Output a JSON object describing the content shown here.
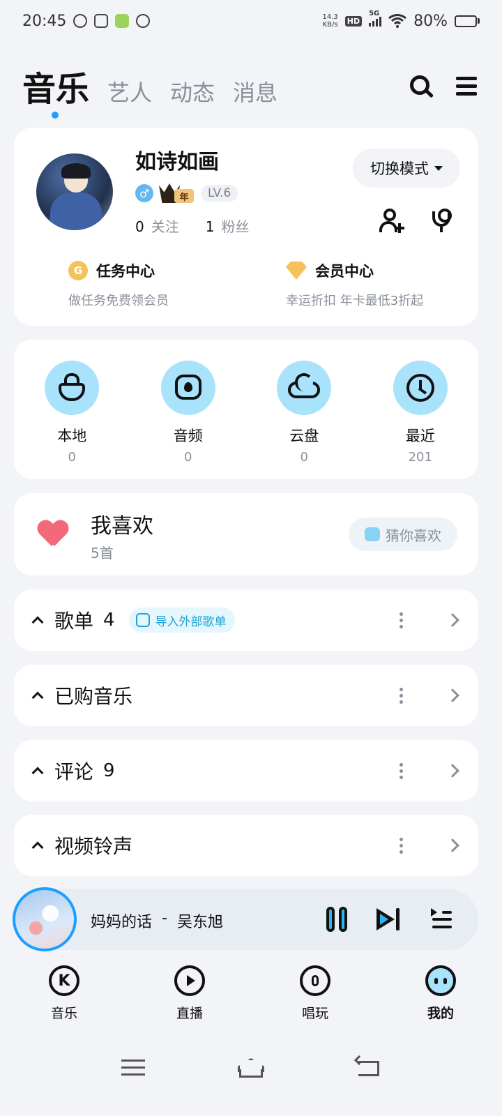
{
  "status_bar": {
    "time": "20:45",
    "net_speed_value": "14.3",
    "net_speed_unit": "KB/s",
    "hd": "HD",
    "network": "5G",
    "battery_text": "80%",
    "battery_level": 0.8
  },
  "top_nav": {
    "tabs": [
      {
        "label": "音乐",
        "active": true
      },
      {
        "label": "艺人"
      },
      {
        "label": "动态"
      },
      {
        "label": "消息"
      }
    ],
    "search_icon": "search-icon",
    "menu_icon": "menu-icon"
  },
  "profile": {
    "username": "如诗如画",
    "gender_symbol": "♂",
    "vip_badge_text": "年",
    "level": "LV.6",
    "following_count": "0",
    "following_label": "关注",
    "followers_count": "1",
    "followers_label": "粉丝",
    "mode_button": "切换模式",
    "tasks": {
      "icon_letter": "G",
      "title": "任务中心",
      "subtitle": "做任务免费领会员"
    },
    "vip": {
      "title": "会员中心",
      "subtitle": "幸运折扣 年卡最低3折起"
    }
  },
  "library": {
    "items": [
      {
        "label": "本地",
        "count": "0",
        "icon": "local-bag-icon"
      },
      {
        "label": "音频",
        "count": "0",
        "icon": "audio-icon"
      },
      {
        "label": "云盘",
        "count": "0",
        "icon": "cloud-icon"
      },
      {
        "label": "最近",
        "count": "201",
        "icon": "clock-icon"
      }
    ]
  },
  "favorites": {
    "title": "我喜欢",
    "count": "5首",
    "guess_button": "猜你喜欢"
  },
  "sections": {
    "playlist": {
      "title": "歌单",
      "count": "4",
      "import_label": "导入外部歌单"
    },
    "purchased": {
      "title": "已购音乐"
    },
    "comments": {
      "title": "评论",
      "count": "9"
    },
    "ringtone": {
      "title": "视频铃声"
    }
  },
  "player": {
    "song": "妈妈的话",
    "separator": "-",
    "artist": "吴东旭"
  },
  "bottom_nav": {
    "items": [
      {
        "label": "音乐",
        "icon_letter": "K"
      },
      {
        "label": "直播"
      },
      {
        "label": "唱玩"
      },
      {
        "label": "我的",
        "active": true
      }
    ]
  },
  "colors": {
    "accent": "#1aa0ff",
    "bubble": "#a9e2fb",
    "heart": "#f26a7a",
    "gold": "#f5c15a",
    "battery": "#f6b50e"
  }
}
